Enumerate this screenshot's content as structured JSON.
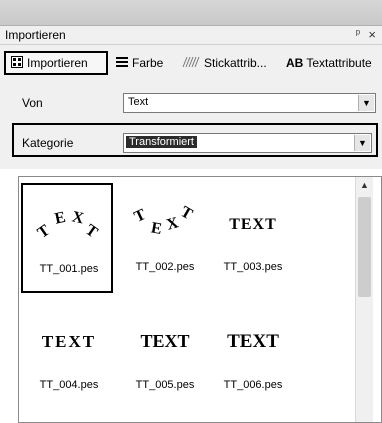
{
  "panel": {
    "title": "Importieren",
    "pin_glyph": "ᵖ",
    "close_glyph": "×"
  },
  "tabs": [
    {
      "label": "Importieren",
      "icon": "import-grid-icon",
      "active": true
    },
    {
      "label": "Farbe",
      "icon": "color-bars-icon",
      "active": false
    },
    {
      "label": "Stickattrib...",
      "icon": "stitch-icon",
      "active": false
    },
    {
      "label": "Textattribute",
      "icon": "ab-text-icon",
      "active": false
    }
  ],
  "form": {
    "von_label": "Von",
    "von_value": "Text",
    "kategorie_label": "Kategorie",
    "kategorie_value": "Transformiert"
  },
  "files": [
    {
      "name": "TT_001.pes",
      "style": "arch",
      "preview_text": "TEXT",
      "selected": true
    },
    {
      "name": "TT_002.pes",
      "style": "wave",
      "preview_text": "TEXT",
      "selected": false
    },
    {
      "name": "TT_003.pes",
      "style": "flat",
      "preview_text": "TEXT",
      "selected": false
    },
    {
      "name": "TT_004.pes",
      "style": "wide",
      "preview_text": "TEXT",
      "selected": false
    },
    {
      "name": "TT_005.pes",
      "style": "bold",
      "preview_text": "TEXT",
      "selected": false
    },
    {
      "name": "TT_006.pes",
      "style": "heavy",
      "preview_text": "TEXT",
      "selected": false
    }
  ]
}
